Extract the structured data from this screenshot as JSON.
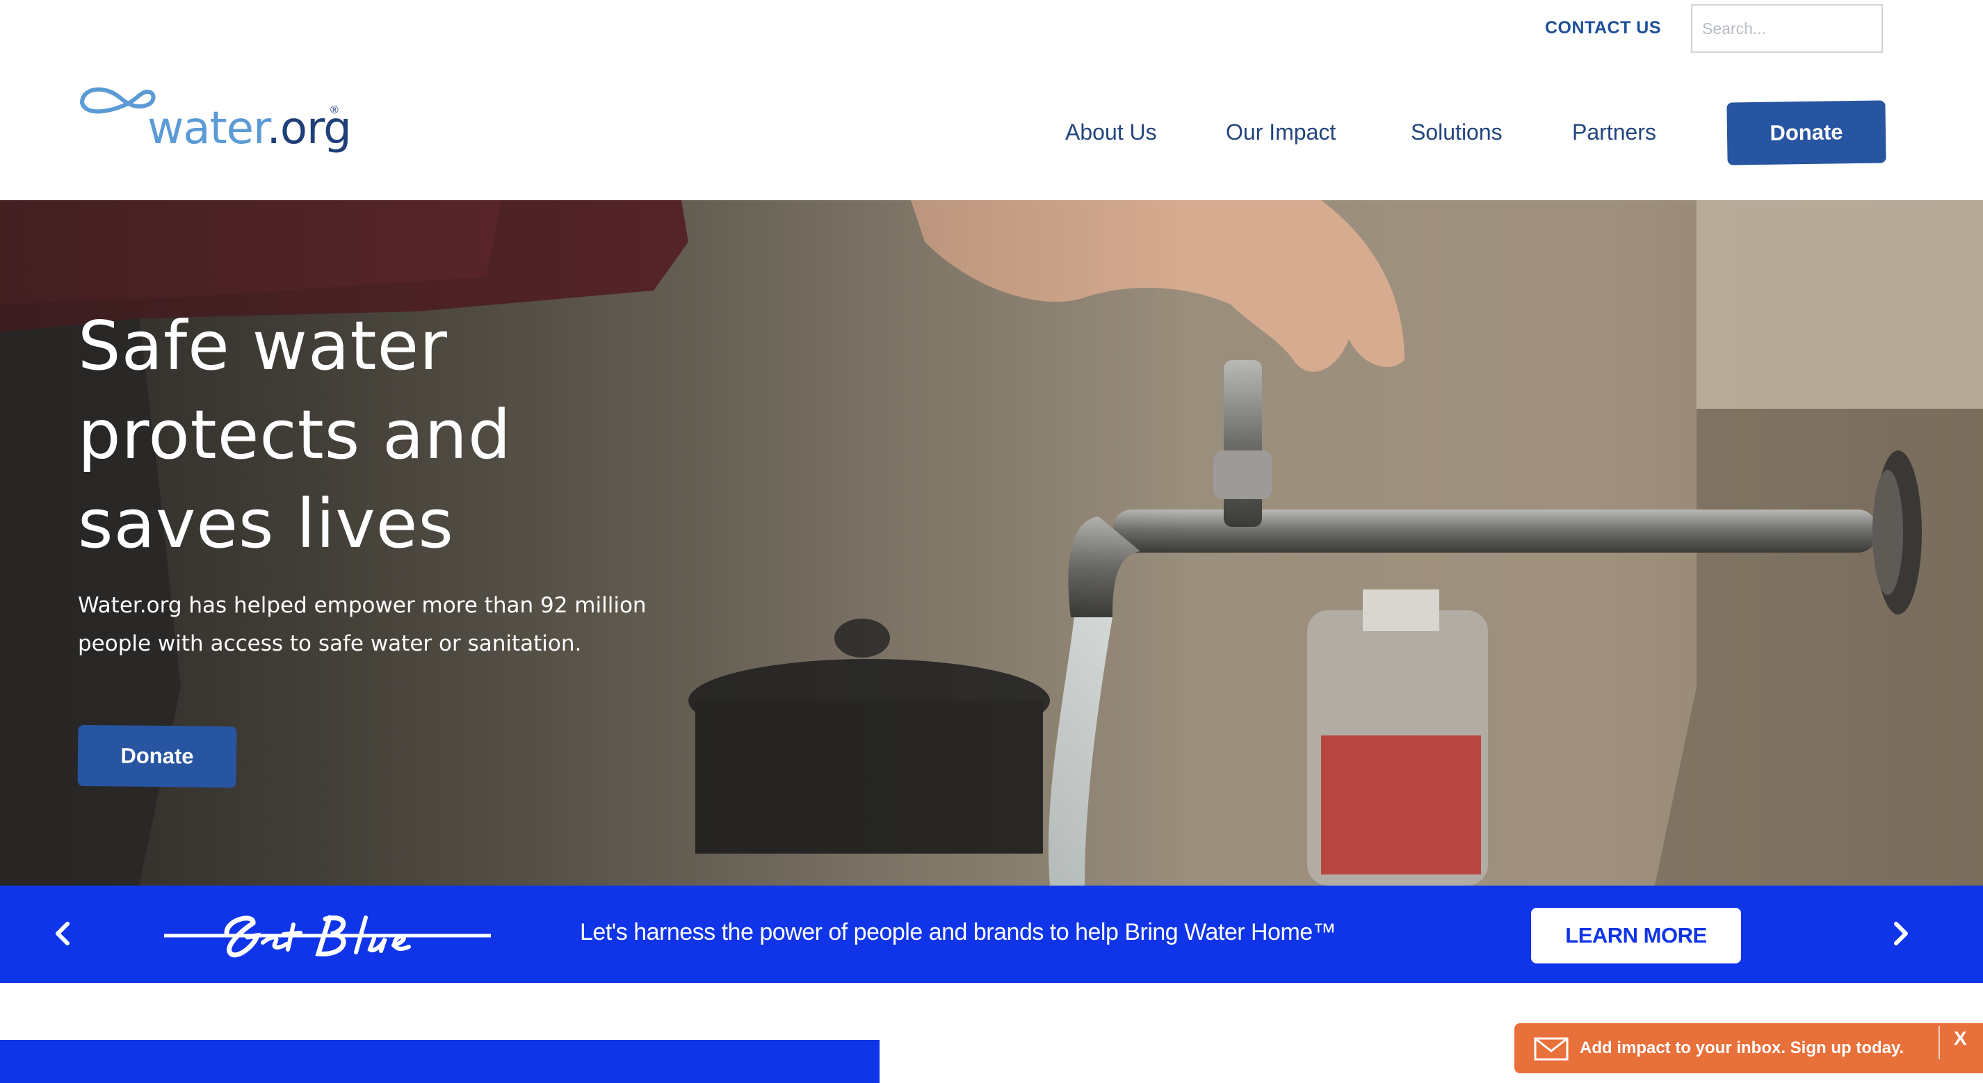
{
  "header": {
    "contact_label": "CONTACT US",
    "search_placeholder": "Search...",
    "logo": {
      "word": "water",
      "dot": ".",
      "suffix": "org",
      "registered": "®"
    },
    "nav": [
      {
        "label": "About Us"
      },
      {
        "label": "Our Impact"
      },
      {
        "label": "Solutions"
      },
      {
        "label": "Partners"
      }
    ],
    "donate_label": "Donate"
  },
  "hero": {
    "title": "Safe water protects and saves lives",
    "description": "Water.org has helped empower more than 92 million people with access to safe water or sanitation.",
    "donate_label": "Donate"
  },
  "banner": {
    "logo_text": "Get Blue",
    "text": "Let's harness the power of people and brands to help Bring Water Home™",
    "cta_label": "LEARN MORE",
    "prev_icon": "chevron-left-icon",
    "next_icon": "chevron-right-icon"
  },
  "signup_toast": {
    "icon": "mail-icon",
    "text": "Add impact to your inbox. Sign up today.",
    "close_label": "X"
  },
  "colors": {
    "brand_blue": "#2755a1",
    "nav_text": "#23457e",
    "banner_blue": "#1035e8",
    "toast_orange": "#e8703a",
    "logo_light_blue": "#5b9bd5"
  }
}
